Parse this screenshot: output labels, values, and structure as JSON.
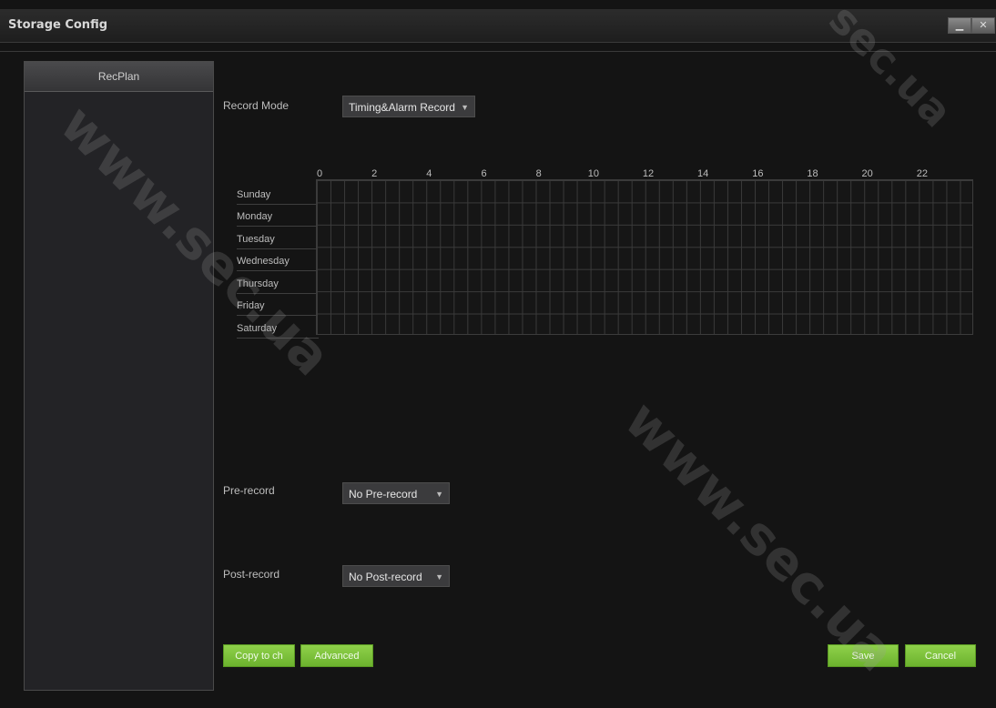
{
  "window": {
    "title": "Storage Config",
    "minimize_icon": "minimize-icon",
    "close_icon": "close-icon",
    "minimize_glyph": "▁",
    "close_glyph": "✕"
  },
  "sidebar": {
    "tab_label": "RecPlan"
  },
  "record_mode": {
    "label": "Record Mode",
    "value": "Timing&Alarm Record"
  },
  "schedule": {
    "hours": [
      "0",
      "2",
      "4",
      "6",
      "8",
      "10",
      "12",
      "14",
      "16",
      "18",
      "20",
      "22"
    ],
    "days": [
      "Sunday",
      "Monday",
      "Tuesday",
      "Wednesday",
      "Thursday",
      "Friday",
      "Saturday"
    ]
  },
  "pre_record": {
    "label": "Pre-record",
    "value": "No Pre-record"
  },
  "post_record": {
    "label": "Post-record",
    "value": "No Post-record"
  },
  "buttons": {
    "copy_to_ch": "Copy to ch",
    "advanced": "Advanced",
    "save": "Save",
    "cancel": "Cancel"
  },
  "watermark": {
    "text_left": "www.sec.ua",
    "text_right": "www.sec.ua",
    "text_top": "sec.ua"
  },
  "colors": {
    "accent_green": "#7cc33a",
    "background": "#141414"
  }
}
